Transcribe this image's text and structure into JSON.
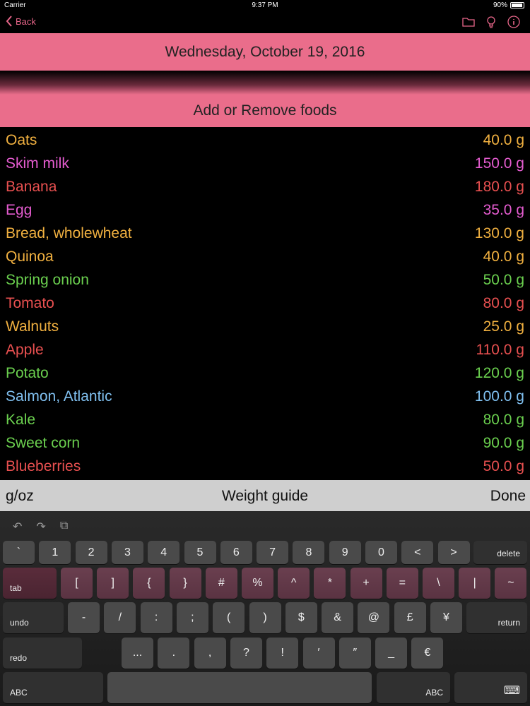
{
  "status": {
    "carrier": "Carrier",
    "time": "9:37 PM",
    "battery": "90%"
  },
  "nav": {
    "back_label": "Back"
  },
  "header": {
    "date": "Wednesday, October 19, 2016",
    "add_remove": "Add or Remove foods"
  },
  "foods": [
    {
      "name": "Oats",
      "amount": "40.0 g",
      "color": "#f0b040"
    },
    {
      "name": "Skim milk",
      "amount": "150.0 g",
      "color": "#e55cd0"
    },
    {
      "name": "Banana",
      "amount": "180.0 g",
      "color": "#e85050"
    },
    {
      "name": "Egg",
      "amount": "35.0 g",
      "color": "#e55cd0"
    },
    {
      "name": "Bread, wholewheat",
      "amount": "130.0 g",
      "color": "#f0b040"
    },
    {
      "name": "Quinoa",
      "amount": "40.0 g",
      "color": "#f0b040"
    },
    {
      "name": "Spring onion",
      "amount": "50.0 g",
      "color": "#6bd04f"
    },
    {
      "name": "Tomato",
      "amount": "80.0 g",
      "color": "#e85050"
    },
    {
      "name": "Walnuts",
      "amount": "25.0 g",
      "color": "#f0b040"
    },
    {
      "name": "Apple",
      "amount": "110.0 g",
      "color": "#e85050"
    },
    {
      "name": "Potato",
      "amount": "120.0 g",
      "color": "#6bd04f"
    },
    {
      "name": "Salmon, Atlantic",
      "amount": "100.0 g",
      "color": "#80c0f0"
    },
    {
      "name": "Kale",
      "amount": "80.0 g",
      "color": "#6bd04f"
    },
    {
      "name": "Sweet corn",
      "amount": "90.0 g",
      "color": "#6bd04f"
    },
    {
      "name": "Blueberries",
      "amount": "50.0 g",
      "color": "#e85050"
    }
  ],
  "toolbar": {
    "units": "g/oz",
    "guide": "Weight guide",
    "done": "Done"
  },
  "keyboard": {
    "row1": [
      "`",
      "1",
      "2",
      "3",
      "4",
      "5",
      "6",
      "7",
      "8",
      "9",
      "0",
      "<",
      ">"
    ],
    "row1_end": "delete",
    "row2_start": "tab",
    "row2": [
      "[",
      "]",
      "{",
      "}",
      "#",
      "%",
      "^",
      "*",
      "+",
      "=",
      "\\",
      "|",
      "~"
    ],
    "row3_start": "undo",
    "row3": [
      "-",
      "/",
      ":",
      ";",
      "(",
      ")",
      "$",
      "&",
      "@",
      "£",
      "¥"
    ],
    "row3_end": "return",
    "row4_start": "redo",
    "row4": [
      "...",
      ".",
      ",",
      "?",
      "!",
      "′",
      "″",
      "_",
      "€"
    ],
    "row5_left": "ABC",
    "row5_right": "ABC"
  }
}
